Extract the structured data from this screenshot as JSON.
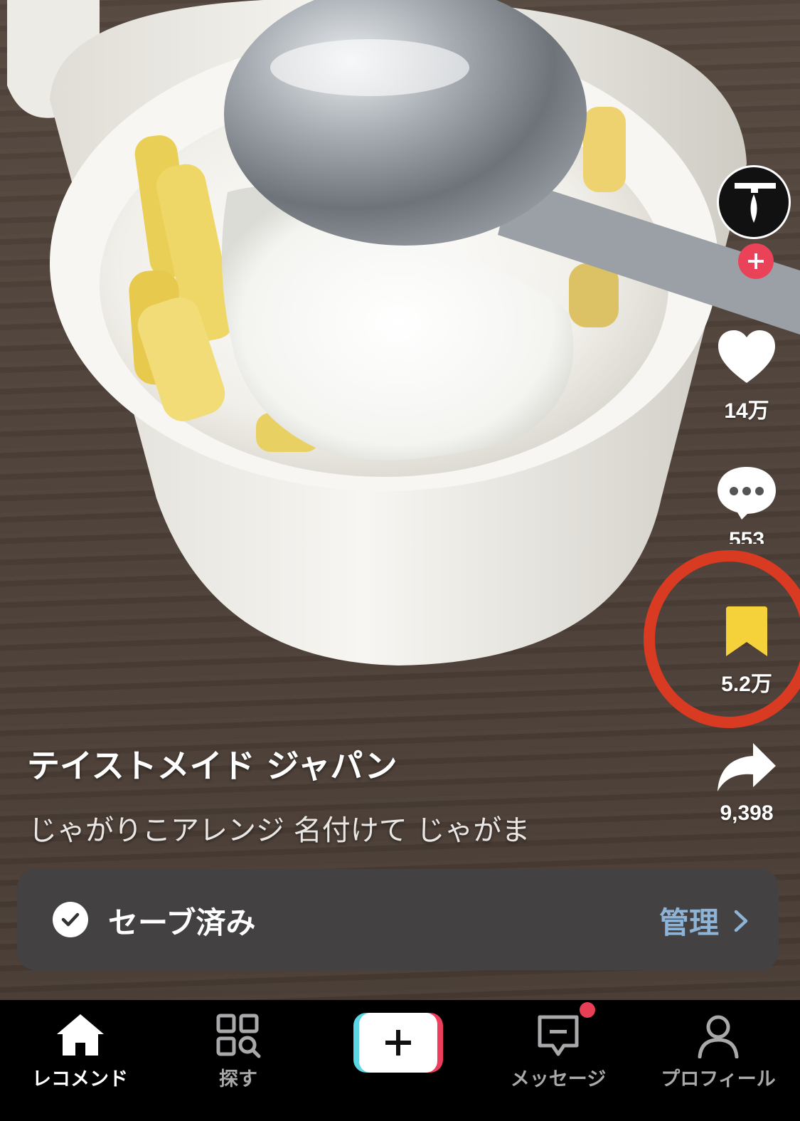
{
  "video": {
    "author": "テイストメイド ジャパン",
    "description": "じゃがりこアレンジ 名付けて じゃがま"
  },
  "actions": {
    "likes": "14万",
    "comments": "553",
    "saves": "5.2万",
    "shares": "9,398"
  },
  "toast": {
    "label": "セーブ済み",
    "manage": "管理"
  },
  "tabbar": {
    "home": "レコメンド",
    "discover": "探す",
    "inbox": "メッセージ",
    "profile": "プロフィール"
  },
  "colors": {
    "save_active": "#f6d23a",
    "follow": "#ea4359",
    "highlight_ring": "#d93a22",
    "manage_link": "#8db4d6"
  },
  "icons": {
    "like": "heart-icon",
    "comment": "comment-bubble-icon",
    "save": "bookmark-icon",
    "share": "share-arrow-icon",
    "home": "home-icon",
    "discover": "discover-grid-icon",
    "create": "plus-icon",
    "inbox": "message-icon",
    "profile": "person-icon"
  }
}
